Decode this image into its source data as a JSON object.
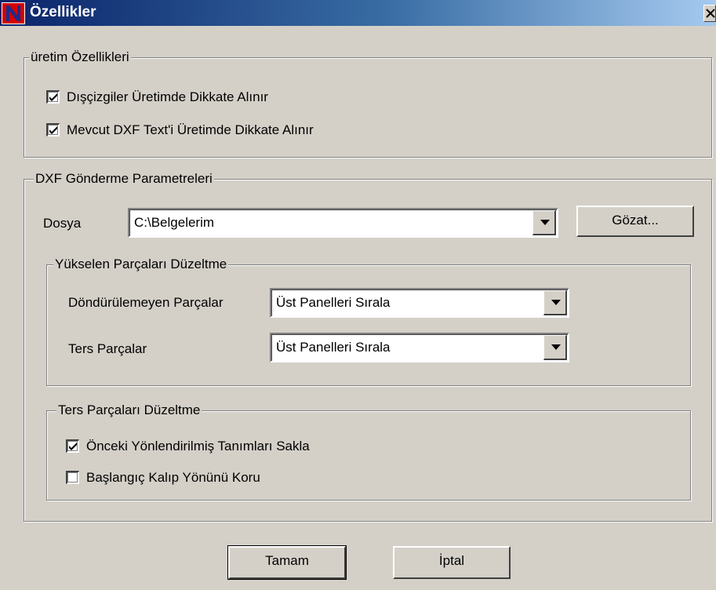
{
  "window": {
    "title": "Özellikler"
  },
  "production_group": {
    "legend": "üretim Özellikleri",
    "options": [
      {
        "label": "Dışçizgiler Üretimde Dikkate Alınır",
        "checked": true
      },
      {
        "label": "Mevcut DXF Text'i Üretimde Dikkate Alınır",
        "checked": true
      }
    ]
  },
  "dxf_group": {
    "legend": "DXF Gönderme Parametreleri",
    "file_label": "Dosya",
    "file_value": "C:\\Belgelerim",
    "browse_label": "Gözat...",
    "rising_group": {
      "legend": "Yükselen Parçaları Düzeltme",
      "unrotatable_label": "Döndürülemeyen Parçalar",
      "unrotatable_value": "Üst Panelleri Sırala",
      "reverse_label": "Ters Parçalar",
      "reverse_value": "Üst Panelleri Sırala"
    },
    "reverse_group": {
      "legend": "Ters Parçaları Düzeltme",
      "options": [
        {
          "label": "Önceki Yönlendirilmiş Tanımları Sakla",
          "checked": true
        },
        {
          "label": "Başlangıç Kalıp Yönünü Koru",
          "checked": false
        }
      ]
    }
  },
  "buttons": {
    "ok": "Tamam",
    "cancel": "İptal"
  },
  "colors": {
    "face": "#d4d0c8",
    "title_start": "#0a246a",
    "title_end": "#a6caf0",
    "icon_red": "#d40000"
  }
}
